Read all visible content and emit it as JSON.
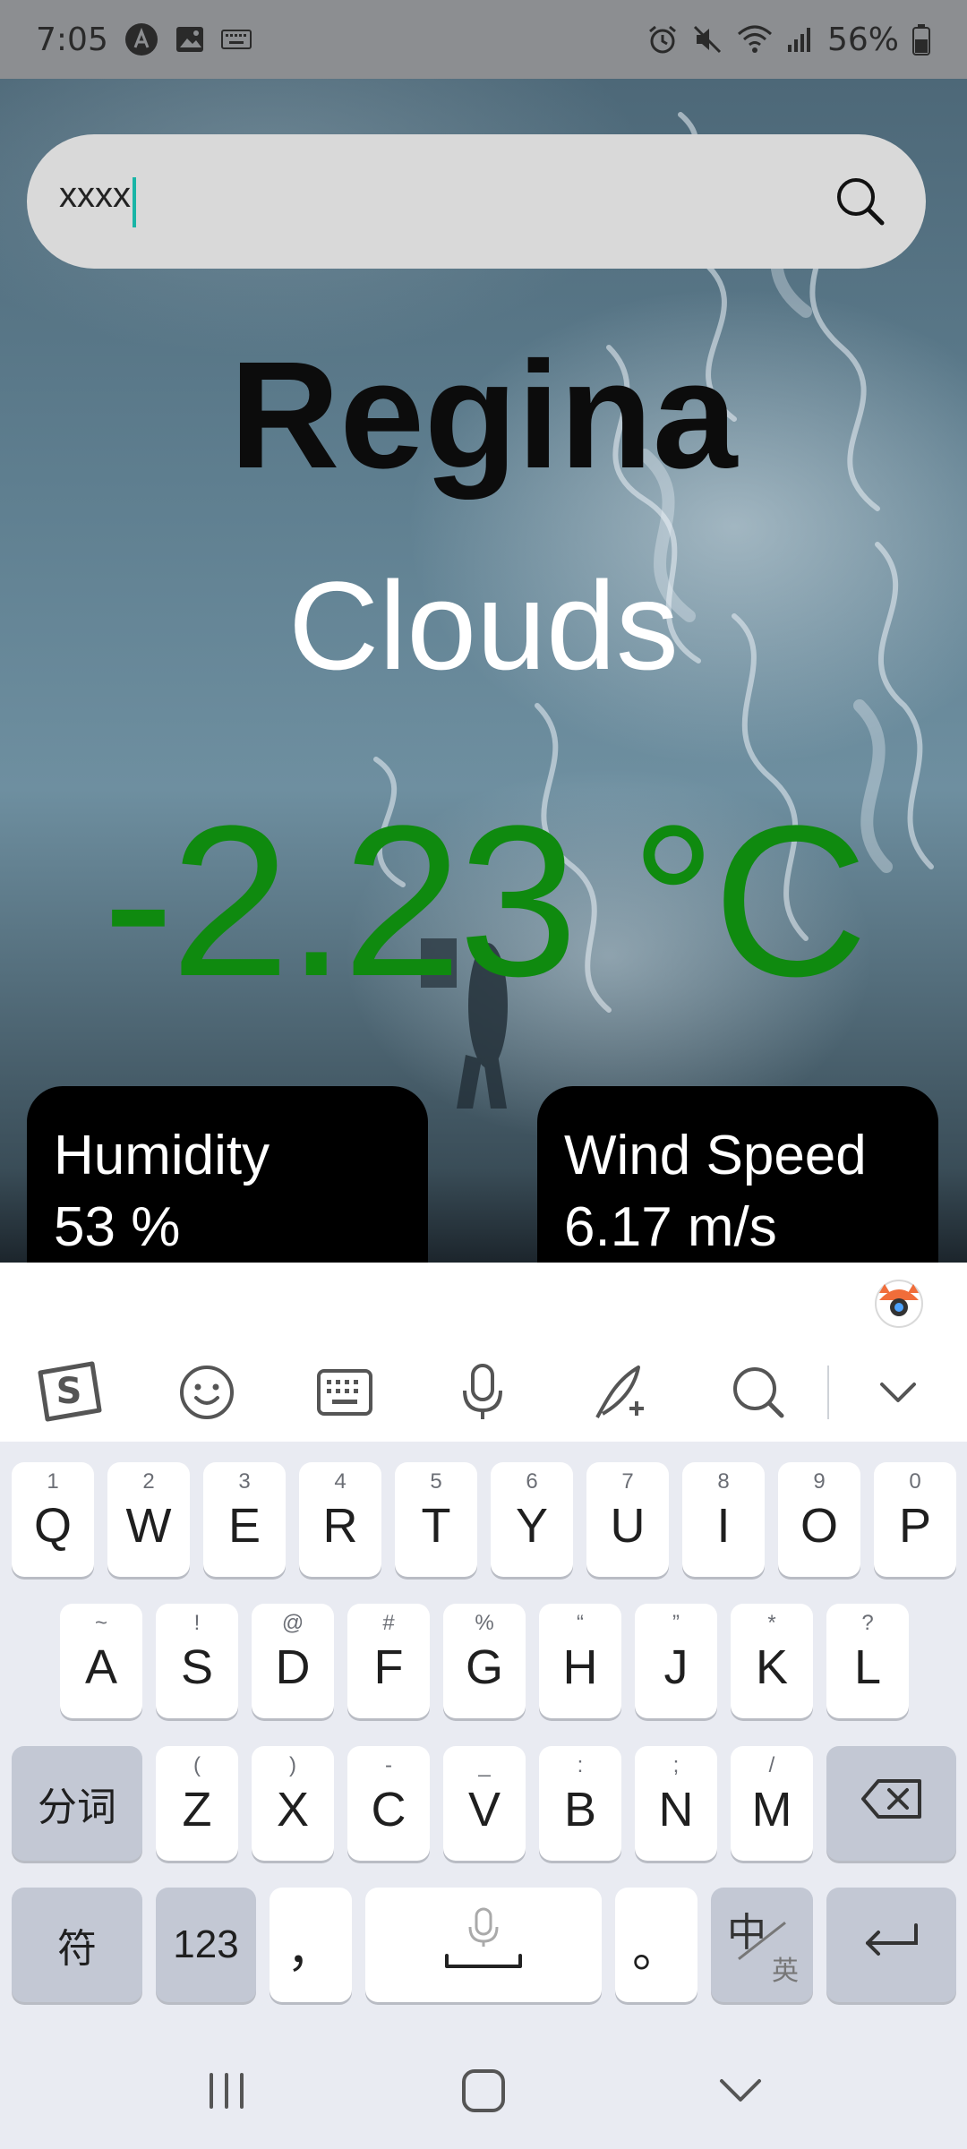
{
  "status_bar": {
    "time": "7:05",
    "battery": "56%",
    "icons": [
      "app-a-icon",
      "image-icon",
      "keyboard-icon",
      "alarm-icon",
      "mute-icon",
      "wifi-icon",
      "signal-icon",
      "battery-icon"
    ]
  },
  "search": {
    "value": "xxxx",
    "icon": "search-icon"
  },
  "weather": {
    "city": "Regina",
    "condition": "Clouds",
    "temperature": "-2.23 °C",
    "temperature_color": "#0f8a0f",
    "humidity_label": "Humidity",
    "humidity_value": "53 %",
    "wind_label": "Wind Speed",
    "wind_value": "6.17 m/s"
  },
  "keyboard": {
    "toolbar": [
      "sogou-logo-icon",
      "emoji-icon",
      "keyboard-icon",
      "mic-icon",
      "handwriting-icon",
      "search-icon",
      "chevron-down-icon"
    ],
    "row1": [
      {
        "hint": "1",
        "key": "Q"
      },
      {
        "hint": "2",
        "key": "W"
      },
      {
        "hint": "3",
        "key": "E"
      },
      {
        "hint": "4",
        "key": "R"
      },
      {
        "hint": "5",
        "key": "T"
      },
      {
        "hint": "6",
        "key": "Y"
      },
      {
        "hint": "7",
        "key": "U"
      },
      {
        "hint": "8",
        "key": "I"
      },
      {
        "hint": "9",
        "key": "O"
      },
      {
        "hint": "0",
        "key": "P"
      }
    ],
    "row2": [
      {
        "hint": "~",
        "key": "A"
      },
      {
        "hint": "!",
        "key": "S"
      },
      {
        "hint": "@",
        "key": "D"
      },
      {
        "hint": "#",
        "key": "F"
      },
      {
        "hint": "%",
        "key": "G"
      },
      {
        "hint": "“",
        "key": "H"
      },
      {
        "hint": "”",
        "key": "J"
      },
      {
        "hint": "*",
        "key": "K"
      },
      {
        "hint": "?",
        "key": "L"
      }
    ],
    "row3": [
      {
        "hint": "(",
        "key": "Z"
      },
      {
        "hint": ")",
        "key": "X"
      },
      {
        "hint": "-",
        "key": "C"
      },
      {
        "hint": "_",
        "key": "V"
      },
      {
        "hint": ":",
        "key": "B"
      },
      {
        "hint": ";",
        "key": "N"
      },
      {
        "hint": "/",
        "key": "M"
      }
    ],
    "split_word": "分词",
    "symbols": "符",
    "numbers": "123",
    "comma": "，",
    "period": "。",
    "lang_top": "中",
    "lang_bottom": "英"
  },
  "navbar": [
    "recent-apps-icon",
    "home-icon",
    "back-icon"
  ]
}
